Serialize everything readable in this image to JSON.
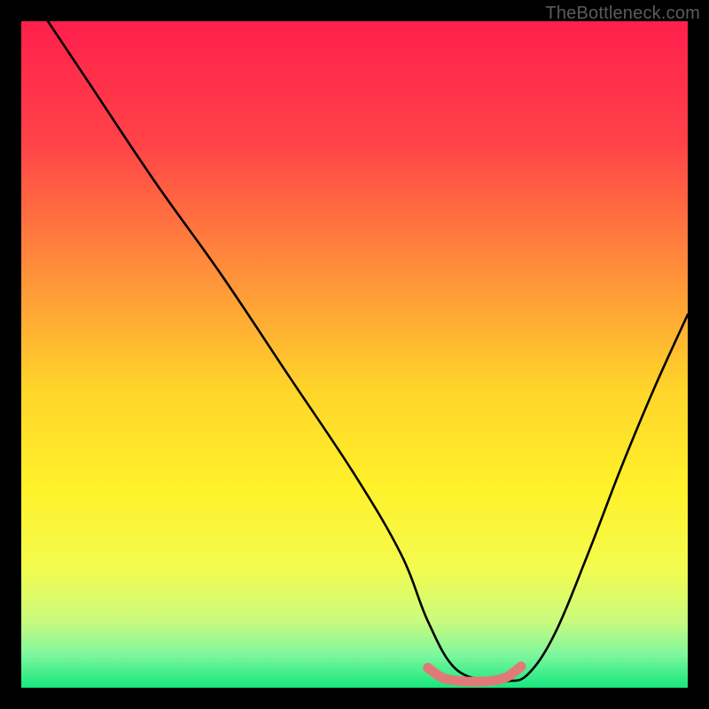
{
  "watermark": "TheBottleneck.com",
  "chart_data": {
    "type": "line",
    "title": "",
    "xlabel": "",
    "ylabel": "",
    "xlim": [
      0,
      100
    ],
    "ylim": [
      0,
      100
    ],
    "background_gradient_stops": [
      {
        "pct": 0,
        "color": "#ff1f4c"
      },
      {
        "pct": 18,
        "color": "#ff4248"
      },
      {
        "pct": 38,
        "color": "#ff913a"
      },
      {
        "pct": 55,
        "color": "#ffd42a"
      },
      {
        "pct": 70,
        "color": "#fff12a"
      },
      {
        "pct": 82,
        "color": "#f3fb4e"
      },
      {
        "pct": 90,
        "color": "#c9fb7e"
      },
      {
        "pct": 95,
        "color": "#7ef79e"
      },
      {
        "pct": 100,
        "color": "#17e77d"
      }
    ],
    "series": [
      {
        "name": "bottleneck-curve",
        "color": "#000000",
        "x": [
          4,
          10,
          20,
          30,
          40,
          50,
          57,
          61,
          65,
          70,
          73,
          76,
          80,
          85,
          90,
          95,
          100
        ],
        "y": [
          100,
          91,
          76,
          62,
          47,
          32,
          20,
          10,
          3,
          1,
          1,
          2,
          8,
          20,
          33,
          45,
          56
        ]
      },
      {
        "name": "valley-marker",
        "color": "#e07a78",
        "x": [
          61,
          63,
          65,
          68,
          71,
          73,
          75
        ],
        "y": [
          3.0,
          1.6,
          1.1,
          0.9,
          1.1,
          1.7,
          3.2
        ]
      }
    ],
    "notes": "No axis ticks or labels are rendered; values estimated on a 0–100 normalized scale from visual proportions."
  }
}
